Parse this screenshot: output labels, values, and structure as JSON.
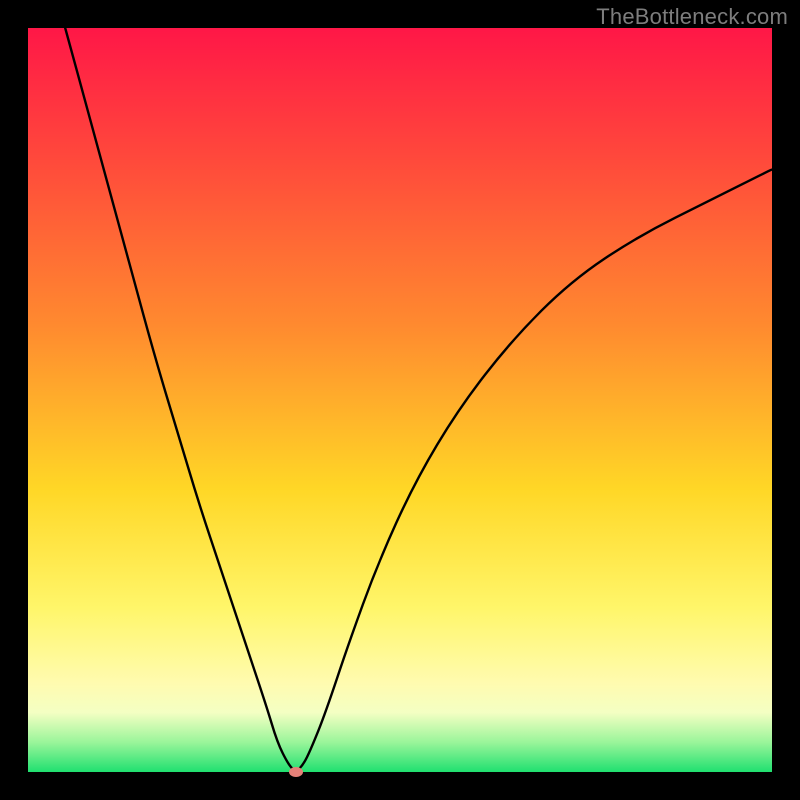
{
  "watermark": "TheBottleneck.com",
  "colors": {
    "frame": "#000000",
    "gradient_top": "#ff1747",
    "gradient_bottom": "#20e070",
    "curve": "#000000",
    "marker": "#e58078"
  },
  "chart_data": {
    "type": "line",
    "title": "",
    "xlabel": "",
    "ylabel": "",
    "xlim": [
      0,
      100
    ],
    "ylim": [
      0,
      100
    ],
    "series": [
      {
        "name": "bottleneck-curve",
        "x": [
          5,
          8,
          11,
          14,
          17,
          20,
          23,
          26,
          29,
          32,
          33.5,
          35,
          36,
          37,
          38,
          40,
          43,
          47,
          52,
          58,
          65,
          73,
          82,
          92,
          100
        ],
        "y": [
          100,
          89,
          78,
          67,
          56,
          46,
          36,
          27,
          18,
          9,
          4,
          1,
          0,
          1,
          3,
          8,
          17,
          28,
          39,
          49,
          58,
          66,
          72,
          77,
          81
        ]
      }
    ],
    "marker": {
      "x": 36,
      "y": 0
    },
    "annotations": []
  }
}
